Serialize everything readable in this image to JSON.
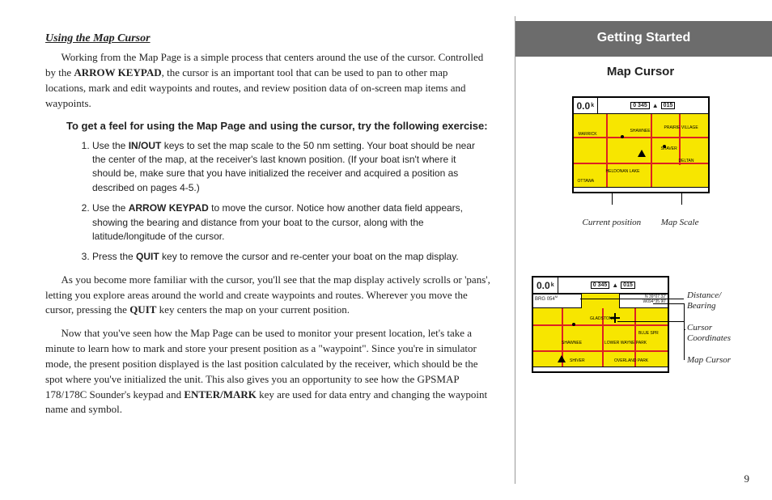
{
  "left": {
    "section_title": "Using the Map Cursor",
    "p1_a": "Working from the Map Page is a simple process that centers around the use of the cursor. Controlled by the ",
    "p1_b": "ARROW KEYPAD",
    "p1_c": ", the cursor is an important tool that can be used to pan to other map locations, mark and edit waypoints and routes, and review position data of on-screen map items and waypoints.",
    "lead": "To get a feel for using the Map Page and using the cursor, try the following exercise:",
    "step1_a": "Use the ",
    "step1_b": "IN/OUT",
    "step1_c": " keys to set the map scale to the 50 nm setting. Your boat should be near the center of the map, at the receiver's last known position. (If your boat isn't where it should be, make sure that you have initialized the receiver and acquired a position as described on pages 4-5.)",
    "step2_a": "Use the ",
    "step2_b": "ARROW KEYPAD",
    "step2_c": " to move the cursor. Notice how another data field appears, showing the bearing and distance from your boat to the cursor, along with the latitude/longitude of the cursor.",
    "step3_a": "Press the ",
    "step3_b": "QUIT",
    "step3_c": " key to remove the cursor and re-center your boat on the map display.",
    "p2_a": "As you become more familiar with the cursor, you'll see that the map display actively scrolls or 'pans', letting you explore areas around the world and create waypoints and routes. Wherever you move the cursor, pressing the ",
    "p2_b": "QUIT",
    "p2_c": " key centers the map on your current position.",
    "p3_a": "Now that you've seen how the Map Page can be used to monitor your present location, let's take a minute to learn how to mark and store your present position as a \"waypoint\". Since you're in simulator mode, the present position displayed is the last position calculated by the receiver, which should be the spot where you've initialized the unit. This also gives you an opportunity to see how the GPSMAP 178/178C Sounder's keypad and ",
    "p3_b": "ENTER/MARK",
    "p3_c": " key are used for data entry and changing the waypoint name and symbol."
  },
  "right": {
    "header": "Getting Started",
    "subhead": "Map Cursor",
    "map1": {
      "speed": "0.0",
      "unit": "k",
      "badge1": "0 345",
      "badge2": "015"
    },
    "cap1_left": "Current position",
    "cap1_right": "Map Scale",
    "map2": {
      "speed": "0.0",
      "unit": "k",
      "badge1": "0 345",
      "badge2": "015",
      "brg_label": "BRG",
      "brg_val": "054",
      "coord1": "N 39°07.32'",
      "coord2": "W094°35.90'"
    },
    "annot_db": "Distance/\nBearing",
    "annot_cc": "Cursor\nCoordinates",
    "annot_mc": "Map Cursor",
    "pagenum": "9"
  }
}
